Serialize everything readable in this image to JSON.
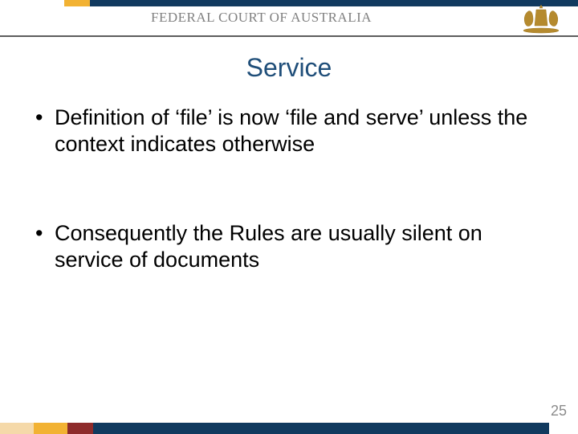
{
  "header": {
    "org_name": "FEDERAL COURT OF AUSTRALIA"
  },
  "title": "Service",
  "bullets": [
    "Definition of ‘file’ is now ‘file and serve’ unless the context indicates otherwise",
    "Consequently the Rules are usually silent on service of documents"
  ],
  "page_number": "25"
}
